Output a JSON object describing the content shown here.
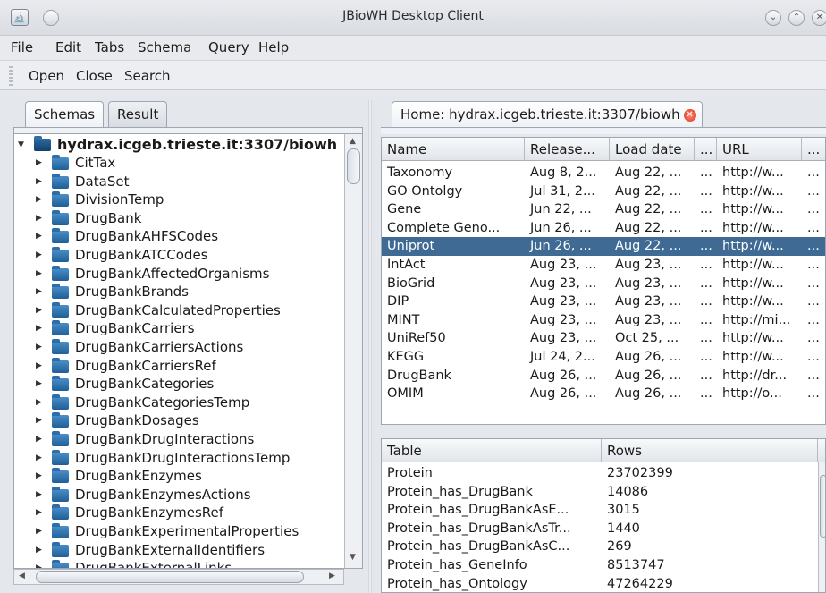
{
  "window": {
    "title": "JBioWH Desktop Client",
    "app_icon_glyph": "🔬",
    "control_1": "⌄",
    "control_2": "⌃",
    "control_3": "✕"
  },
  "menubar": {
    "items": [
      "File",
      "Edit",
      "Tabs",
      "Schema",
      "Query",
      "Help"
    ]
  },
  "toolbar": {
    "open_label": "Open",
    "close_label": "Close",
    "search_label": "Search"
  },
  "left_panel": {
    "tabs": [
      "Schemas",
      "Result"
    ],
    "tree_root": "hydrax.icgeb.trieste.it:3307/biowh",
    "tree_items": [
      "CitTax",
      "DataSet",
      "DivisionTemp",
      "DrugBank",
      "DrugBankAHFSCodes",
      "DrugBankATCCodes",
      "DrugBankAffectedOrganisms",
      "DrugBankBrands",
      "DrugBankCalculatedProperties",
      "DrugBankCarriers",
      "DrugBankCarriersActions",
      "DrugBankCarriersRef",
      "DrugBankCategories",
      "DrugBankCategoriesTemp",
      "DrugBankDosages",
      "DrugBankDrugInteractions",
      "DrugBankDrugInteractionsTemp",
      "DrugBankEnzymes",
      "DrugBankEnzymesActions",
      "DrugBankEnzymesRef",
      "DrugBankExperimentalProperties",
      "DrugBankExternalIdentifiers",
      "DrugBankExternalLinks"
    ]
  },
  "right_panel": {
    "home_tab_label": "Home: hydrax.icgeb.trieste.it:3307/biowh",
    "datasets": {
      "columns": [
        "Name",
        "Release...",
        "Load date",
        "...",
        "URL",
        "..."
      ],
      "rows": [
        [
          "Taxonomy",
          "Aug 8, 2...",
          "Aug 22, ...",
          "...",
          "http://w...",
          "..."
        ],
        [
          "GO Ontolgy",
          "Jul 31, 2...",
          "Aug 22, ...",
          "...",
          "http://w...",
          "..."
        ],
        [
          "Gene",
          "Jun 22, ...",
          "Aug 22, ...",
          "...",
          "http://w...",
          "..."
        ],
        [
          "Complete Geno...",
          "Jun 26, ...",
          "Aug 22, ...",
          "...",
          "http://w...",
          "..."
        ],
        [
          "Uniprot",
          "Jun 26, ...",
          "Aug 22, ...",
          "...",
          "http://w...",
          "..."
        ],
        [
          "IntAct",
          "Aug 23, ...",
          "Aug 23, ...",
          "...",
          "http://w...",
          "..."
        ],
        [
          "BioGrid",
          "Aug 23, ...",
          "Aug 23, ...",
          "...",
          "http://w...",
          "..."
        ],
        [
          "DIP",
          "Aug 23, ...",
          "Aug 23, ...",
          "...",
          "http://w...",
          "..."
        ],
        [
          "MINT",
          "Aug 23, ...",
          "Aug 23, ...",
          "...",
          "http://mi...",
          "..."
        ],
        [
          "UniRef50",
          "Aug 23, ...",
          "Oct 25, ...",
          "...",
          "http://w...",
          "..."
        ],
        [
          "KEGG",
          "Jul 24, 2...",
          "Aug 26, ...",
          "...",
          "http://w...",
          "..."
        ],
        [
          "DrugBank",
          "Aug 26, ...",
          "Aug 26, ...",
          "...",
          "http://dr...",
          "..."
        ],
        [
          "OMIM",
          "Aug 26, ...",
          "Aug 26, ...",
          "...",
          "http://o...",
          "..."
        ]
      ],
      "selected_row_name": "Uniprot"
    },
    "tables": {
      "columns": [
        "Table",
        "Rows"
      ],
      "rows": [
        [
          "Protein",
          "23702399"
        ],
        [
          "Protein_has_DrugBank",
          "14086"
        ],
        [
          "Protein_has_DrugBankAsE...",
          "3015"
        ],
        [
          "Protein_has_DrugBankAsTr...",
          "1440"
        ],
        [
          "Protein_has_DrugBankAsC...",
          "269"
        ],
        [
          "Protein_has_GeneInfo",
          "8513747"
        ],
        [
          "Protein_has_Ontology",
          "47264229"
        ]
      ]
    }
  },
  "colors": {
    "selection": "#3e6a94",
    "folder": "#2d6ea8",
    "close_tab": "#d9321f"
  }
}
